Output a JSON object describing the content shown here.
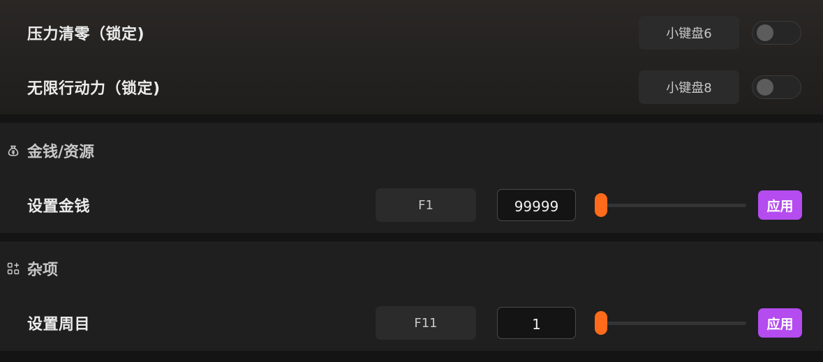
{
  "cheats_top": [
    {
      "label": "压力清零（锁定)",
      "hotkey": "小键盘6",
      "enabled": false
    },
    {
      "label": "无限行动力（锁定)",
      "hotkey": "小键盘8",
      "enabled": false
    }
  ],
  "money_section": {
    "title": "金钱/资源",
    "icon": "money-bag-icon",
    "row": {
      "label": "设置金钱",
      "hotkey": "F1",
      "value": "99999",
      "slider_fraction": 0,
      "apply_label": "应用"
    }
  },
  "misc_section": {
    "title": "杂项",
    "icon": "apps-grid-icon",
    "row": {
      "label": "设置周目",
      "hotkey": "F11",
      "value": "1",
      "slider_fraction": 0,
      "apply_label": "应用"
    }
  },
  "colors": {
    "accent_slider": "#ff6b1a",
    "apply_button": "#b44cf0",
    "background": "#1f1f1f"
  }
}
